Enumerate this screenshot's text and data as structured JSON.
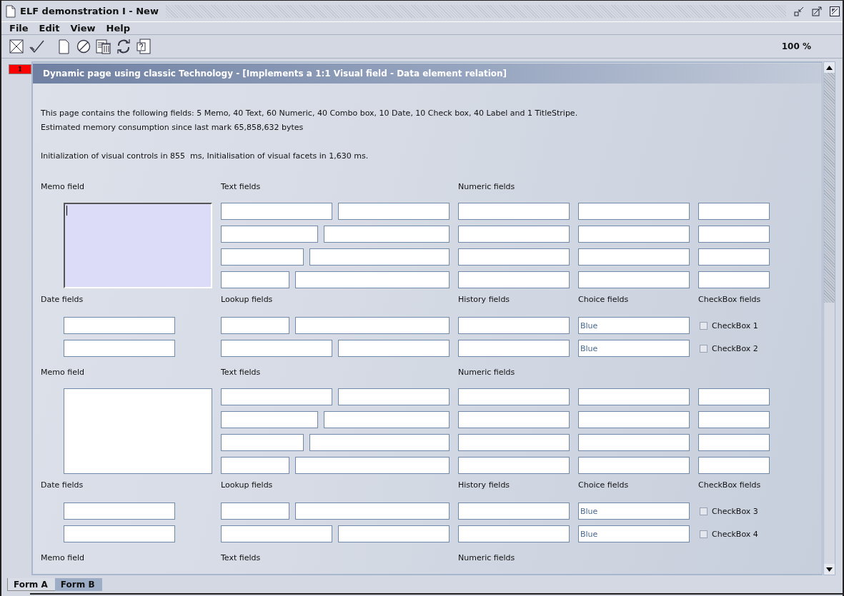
{
  "window": {
    "title": "ELF demonstration I - New"
  },
  "menu": [
    {
      "label": "File"
    },
    {
      "label": "Edit"
    },
    {
      "label": "View"
    },
    {
      "label": "Help"
    }
  ],
  "zoom": "100 %",
  "page_marker": "1",
  "page": {
    "title": "Dynamic page using classic Technology - [Implements a 1:1 Visual field - Data element relation]",
    "summary": [
      "This page contains the following fields: 5 Memo, 40 Text, 60 Numeric, 40 Combo box, 10 Date, 10 Check box, 40 Label and 1 TitleStripe.",
      "Estimated memory consumption since last mark 65,858,632 bytes"
    ],
    "timing": "Initialization of visual controls in 855  ms, Initialisation of visual facets in 1,630 ms.",
    "sections": [
      {
        "memo_label": "Memo field",
        "text_label": "Text fields",
        "numeric_label": "Numeric fields",
        "memo_focused": true,
        "date_label": "Date fields",
        "lookup_label": "Lookup fields",
        "history_label": "History fields",
        "choice_label": "Choice fields",
        "checkbox_label": "CheckBox fields",
        "choices": [
          "Blue",
          "Blue"
        ],
        "checkboxes": [
          {
            "label": "CheckBox 1",
            "checked": false
          },
          {
            "label": "CheckBox 2",
            "checked": false
          }
        ]
      },
      {
        "memo_label": "Memo field",
        "text_label": "Text fields",
        "numeric_label": "Numeric fields",
        "memo_focused": false,
        "date_label": "Date fields",
        "lookup_label": "Lookup fields",
        "history_label": "History fields",
        "choice_label": "Choice fields",
        "checkbox_label": "CheckBox fields",
        "choices": [
          "Blue",
          "Blue"
        ],
        "checkboxes": [
          {
            "label": "CheckBox 3",
            "checked": false
          },
          {
            "label": "CheckBox 4",
            "checked": false
          }
        ]
      },
      {
        "memo_label": "Memo field",
        "text_label": "Text fields",
        "numeric_label": "Numeric fields"
      }
    ]
  },
  "form_tabs": [
    {
      "label": "Form A",
      "selected": true
    },
    {
      "label": "Form B",
      "selected": false
    }
  ]
}
